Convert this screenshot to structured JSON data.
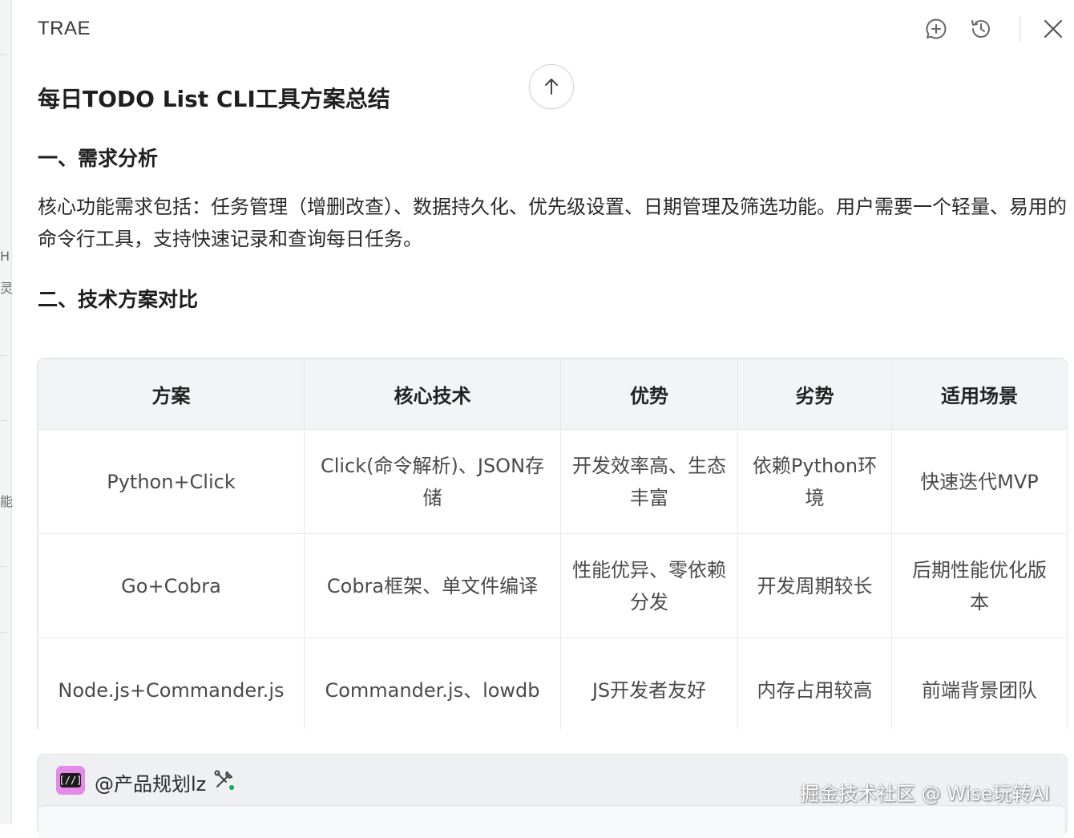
{
  "app": {
    "title": "TRAE"
  },
  "header_icons": [
    "new-chat-icon",
    "history-icon",
    "close-icon"
  ],
  "left_strip": {
    "glyphs": [
      "H",
      "灵",
      "能"
    ]
  },
  "document": {
    "title": "每日TODO List CLI工具方案总结",
    "section1": {
      "heading": "一、需求分析"
    },
    "paragraph": "核心功能需求包括：任务管理（增删改查）、数据持久化、优先级设置、日期管理及筛选功能。用户需要一个轻量、易用的命令行工具，支持快速记录和查询每日任务。",
    "section2": {
      "heading": "二、技术方案对比"
    }
  },
  "table": {
    "headers": [
      "方案",
      "核心技术",
      "优势",
      "劣势",
      "适用场景"
    ],
    "rows": [
      [
        "Python+Click",
        "Click(命令解析)、JSON存储",
        "开发效率高、生态丰富",
        "依赖Python环境",
        "快速迭代MVP"
      ],
      [
        "Go+Cobra",
        "Cobra框架、单文件编译",
        "性能优异、零依赖分发",
        "开发周期较长",
        "后期性能优化版本"
      ],
      [
        "Node.js+Commander.js",
        "Commander.js、lowdb",
        "JS开发者友好",
        "内存占用较高",
        "前端背景团队"
      ]
    ]
  },
  "composer": {
    "agent_name": "@产品规划lz",
    "avatar_text": "[//]"
  },
  "watermark": "掘金技术社区 @ Wise玩转AI",
  "colors": {
    "accent_avatar": "#e58ae8",
    "header_bg": "#f3f4f6",
    "status_dot": "#22b14c"
  }
}
